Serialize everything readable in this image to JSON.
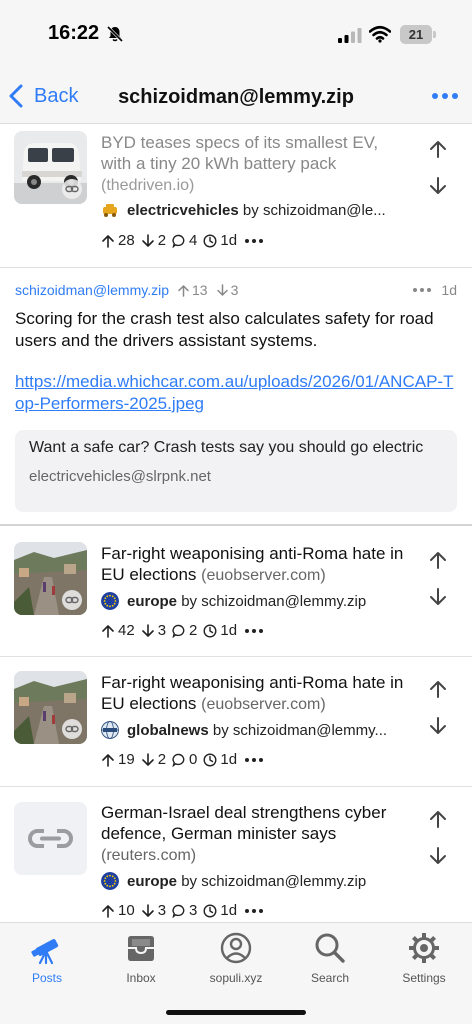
{
  "status": {
    "time": "16:22",
    "battery": "21"
  },
  "nav": {
    "back_label": "Back",
    "title": "schizoidman@lemmy.zip",
    "more_icon": "ellipsis-icon"
  },
  "posts": [
    {
      "title": "BYD teases specs of its smallest EV, with a tiny 20 kWh battery pack",
      "domain": "(thedriven.io)",
      "community": "electricvehicles",
      "by": "by",
      "author": "schizoidman@le...",
      "upvotes": "28",
      "downvotes": "2",
      "comments": "4",
      "age": "1d"
    },
    {
      "title": "Far-right weaponising anti-Roma hate in EU elections",
      "domain": "(euobserver.com)",
      "community": "europe",
      "by": "by",
      "author": "schizoidman@lemmy.zip",
      "upvotes": "42",
      "downvotes": "3",
      "comments": "2",
      "age": "1d"
    },
    {
      "title": "Far-right weaponising anti-Roma hate in EU elections",
      "domain": "(euobserver.com)",
      "community": "globalnews",
      "by": "by",
      "author": "schizoidman@lemmy...",
      "upvotes": "19",
      "downvotes": "2",
      "comments": "0",
      "age": "1d"
    },
    {
      "title": "German-Israel deal strengthens cyber defence, German minister says",
      "domain": "(reuters.com)",
      "community": "europe",
      "by": "by",
      "author": "schizoidman@lemmy.zip",
      "upvotes": "10",
      "downvotes": "3",
      "comments": "3",
      "age": "1d"
    }
  ],
  "comment": {
    "author": "schizoidman@lemmy.zip",
    "upvotes": "13",
    "downvotes": "3",
    "age": "1d",
    "body": "Scoring for the crash test also calculates safety for road users and the drivers assistant systems.",
    "link": "https://media.whichcar.com.au/uploads/2026/01/ANCAP-Top-Performers-2025.jpeg",
    "parent_title": "Want a safe car? Crash tests say you should go electric",
    "parent_community": "electricvehicles@slrpnk.net"
  },
  "tabs": [
    {
      "label": "Posts",
      "icon": "telescope-icon",
      "active": true
    },
    {
      "label": "Inbox",
      "icon": "inbox-tray-icon"
    },
    {
      "label": "sopuli.xyz",
      "icon": "person-circle-icon"
    },
    {
      "label": "Search",
      "icon": "magnifier-icon"
    },
    {
      "label": "Settings",
      "icon": "gear-icon"
    }
  ],
  "colors": {
    "accent": "#2f7cf6",
    "text": "#111111",
    "secondary": "#888888",
    "bar_background": "#f6f6f6"
  }
}
